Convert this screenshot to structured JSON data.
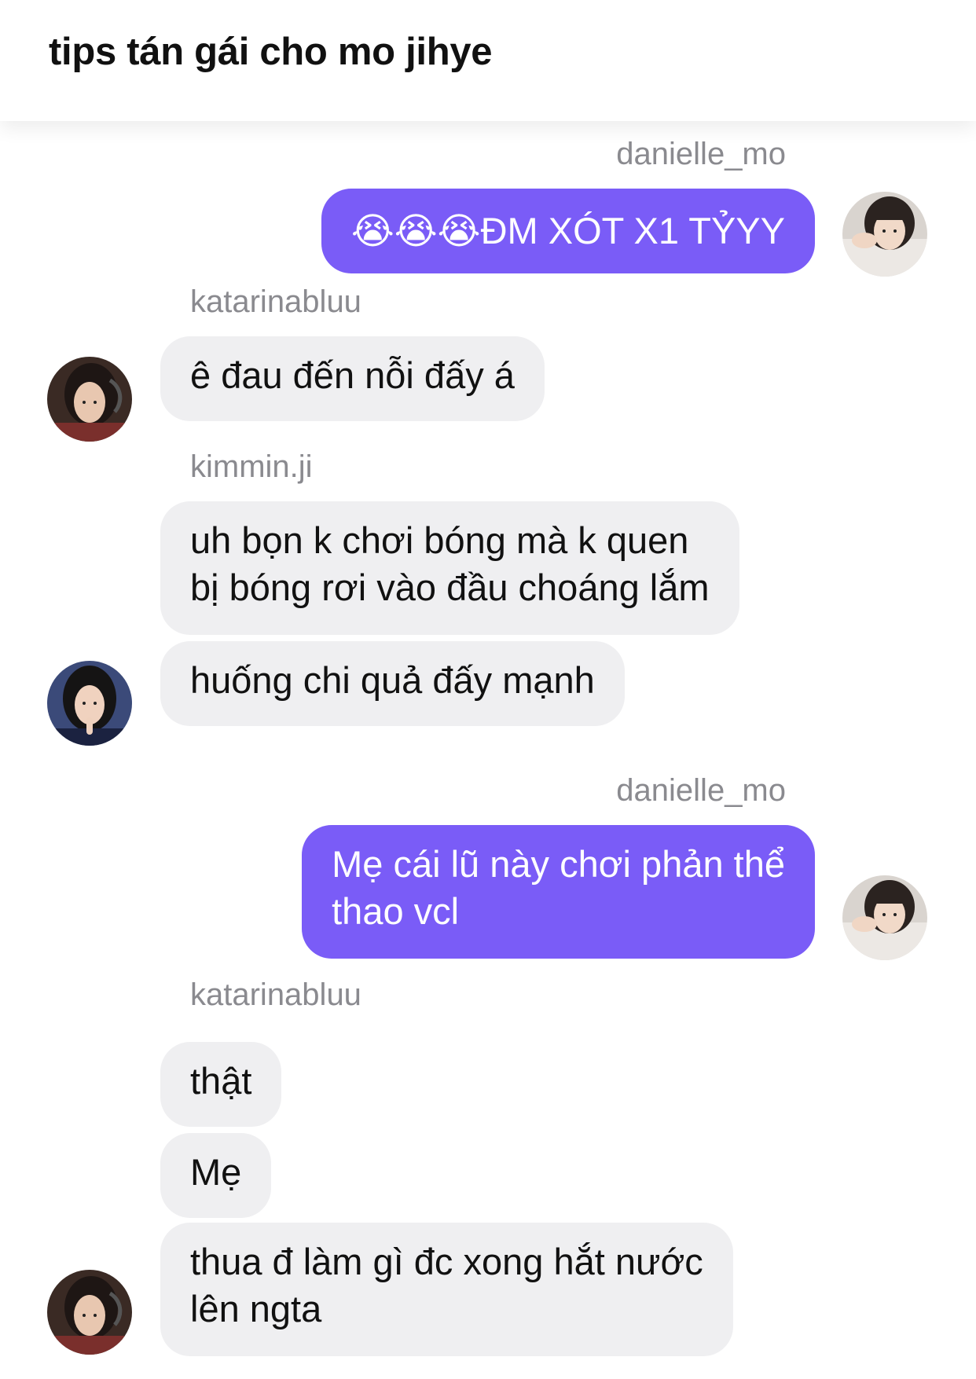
{
  "header": {
    "title": "tips tán gái cho mo jihye"
  },
  "messages": [
    {
      "sender": "danielle_mo",
      "direction": "out",
      "lines": [
        "😭😭😭ĐM XÓT X1 TỶYY"
      ]
    },
    {
      "sender": "katarinabluu",
      "direction": "in",
      "lines": [
        "ê đau đến nỗi đấy á"
      ]
    },
    {
      "sender": "kimmin.ji",
      "direction": "in",
      "lines": [
        "uh bọn k chơi bóng mà k quen",
        "bị bóng rơi vào đầu choáng lắm"
      ]
    },
    {
      "sender": "kimmin.ji",
      "direction": "in",
      "lines": [
        "huống chi quả đấy mạnh"
      ]
    },
    {
      "sender": "danielle_mo",
      "direction": "out",
      "lines": [
        "Mẹ cái lũ này chơi phản thể",
        "thao vcl"
      ]
    },
    {
      "sender": "katarinabluu",
      "direction": "in",
      "lines": [
        "thật"
      ]
    },
    {
      "sender": "katarinabluu",
      "direction": "in",
      "lines": [
        "Mẹ"
      ]
    },
    {
      "sender": "katarinabluu",
      "direction": "in",
      "lines": [
        "thua đ làm gì đc xong hắt nước",
        "lên ngta"
      ]
    }
  ],
  "colors": {
    "outgoing_bubble": "#7a5cf7",
    "incoming_bubble": "#efeff1",
    "sender_name": "#8a8a8f"
  },
  "avatars": [
    "avatar-danielle",
    "avatar-katarina",
    "avatar-minji"
  ]
}
